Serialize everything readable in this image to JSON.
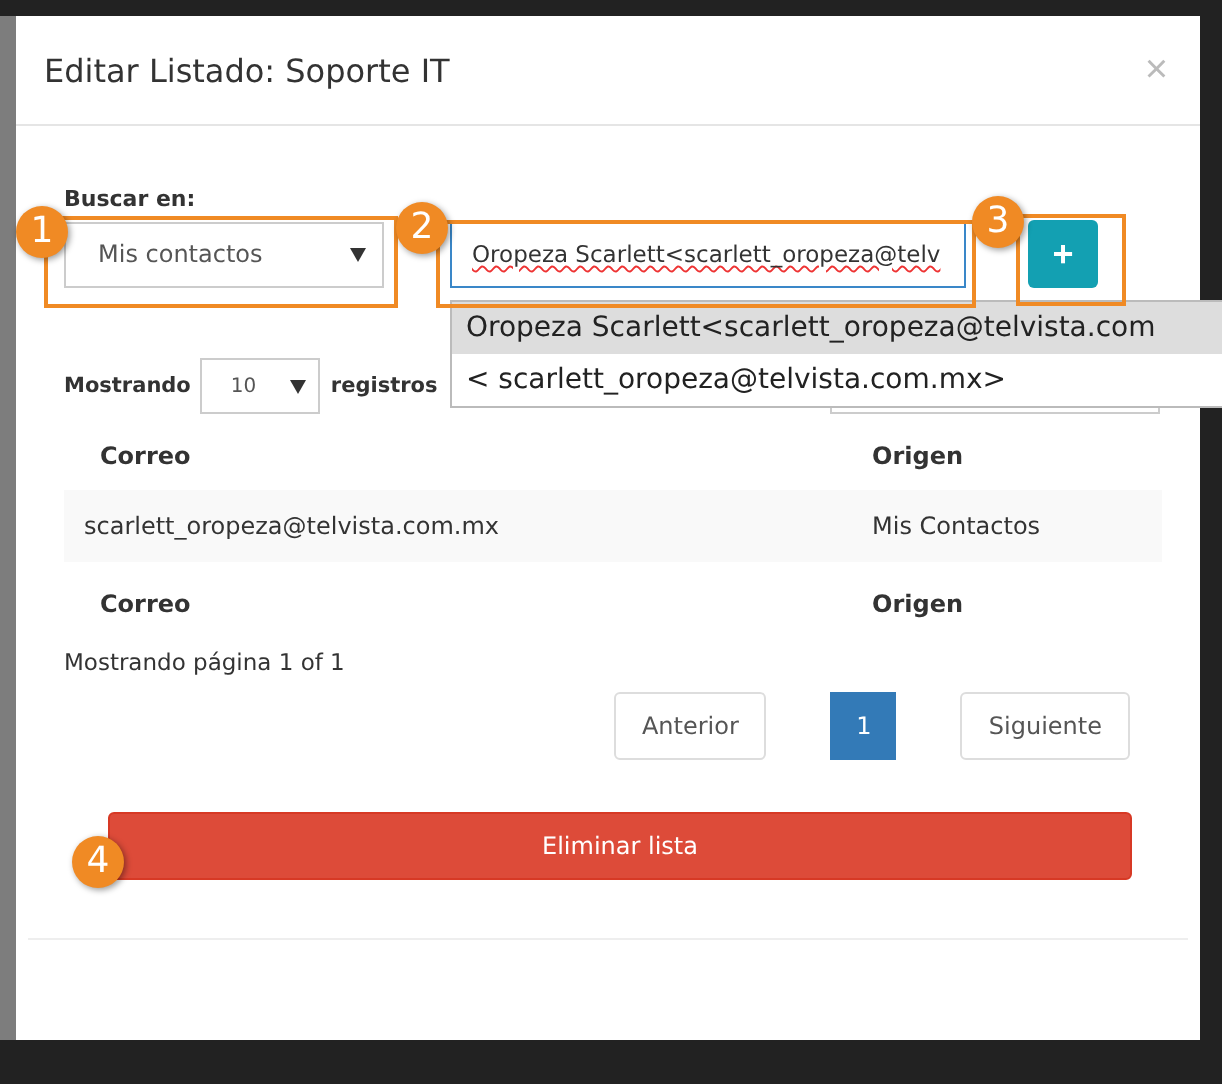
{
  "modal": {
    "title": "Editar Listado: Soporte IT",
    "close": "×"
  },
  "search": {
    "label": "Buscar en:",
    "source": "Mis contactos",
    "value": "Oropeza Scarlett<scarlett_oropeza@telv",
    "add": "+"
  },
  "suggestions": [
    {
      "text": "Oropeza Scarlett<scarlett_oropeza@telvista.com",
      "selected": true
    },
    {
      "text": "< scarlett_oropeza@telvista.com.mx>",
      "selected": false
    }
  ],
  "length": {
    "before": "Mostrando",
    "value": "10",
    "after": "registros"
  },
  "table": {
    "columns": [
      "Correo",
      "Origen"
    ],
    "rows": [
      [
        "scarlett_oropeza@telvista.com.mx",
        "Mis Contactos"
      ]
    ]
  },
  "footer_columns": [
    "Correo",
    "Origen"
  ],
  "info": "Mostrando página 1 of 1",
  "pagination": [
    {
      "label": "Anterior",
      "selected": false
    },
    {
      "label": "1",
      "selected": true
    },
    {
      "label": "Siguiente",
      "selected": false
    }
  ],
  "delete_button": "Eliminar lista",
  "callouts": [
    "1",
    "2",
    "3",
    "4"
  ]
}
